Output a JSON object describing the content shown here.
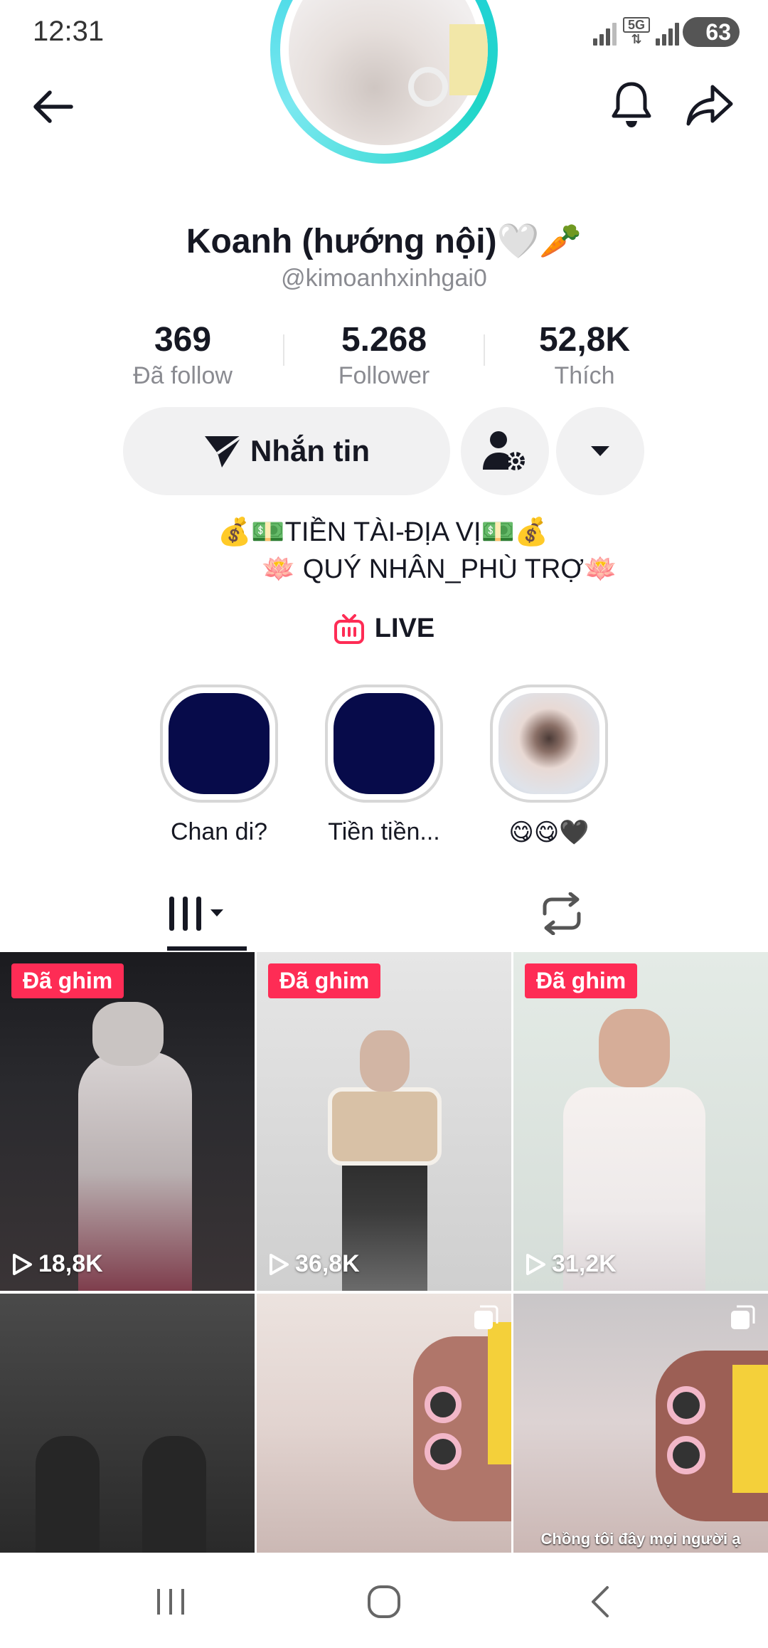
{
  "status_bar": {
    "time": "12:31",
    "network": "5G",
    "battery": "63"
  },
  "header": {
    "back_icon": "arrow-left-icon",
    "bell_icon": "bell-icon",
    "share_icon": "share-icon"
  },
  "profile": {
    "display_name": "Koanh (hướng nội)🤍🥕",
    "username": "@kimoanhxinhgai0",
    "stats": [
      {
        "value": "369",
        "label": "Đã follow"
      },
      {
        "value": "5.268",
        "label": "Follower"
      },
      {
        "value": "52,8K",
        "label": "Thích"
      }
    ],
    "message_label": "Nhắn tin",
    "bio": [
      "💰💵TIỀN TÀI-ĐỊA VỊ💵💰",
      "🪷 QUÝ NHÂN_PHÙ TRỢ🪷"
    ],
    "live_label": "LIVE"
  },
  "highlights": [
    {
      "label": "Chan di?"
    },
    {
      "label": "Tiền tiền..."
    },
    {
      "label": "😋😋🖤"
    }
  ],
  "videos": [
    {
      "pinned": "Đã ghim",
      "views": "18,8K"
    },
    {
      "pinned": "Đã ghim",
      "views": "36,8K"
    },
    {
      "pinned": "Đã ghim",
      "views": "31,2K"
    },
    {
      "views": ""
    },
    {
      "views": ""
    },
    {
      "caption": "Chồng tôi đây mọi người ạ"
    }
  ],
  "colors": {
    "accent": "#fe2c55",
    "ring": "#25d0e0",
    "highlight_dark": "#070b4a"
  }
}
